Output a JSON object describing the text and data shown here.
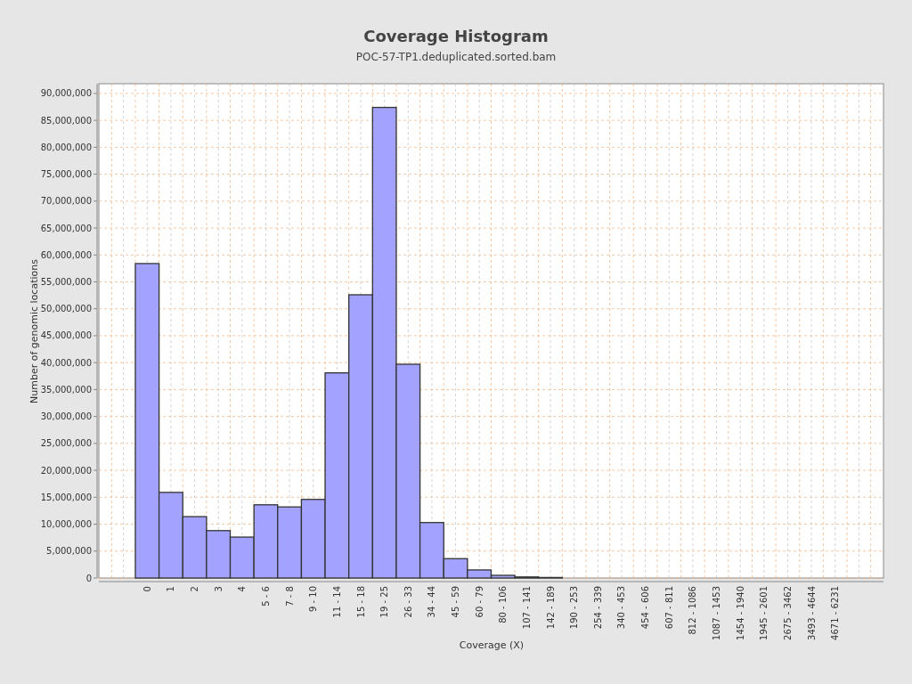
{
  "subtitle": "POC-57-TP1.deduplicated.sorted.bam",
  "chart_data": {
    "type": "bar",
    "title": "Coverage Histogram",
    "xlabel": "Coverage (X)",
    "ylabel": "Number of genomic locations",
    "categories": [
      "0",
      "1",
      "2",
      "3",
      "4",
      "5 - 6",
      "7 - 8",
      "9 - 10",
      "11 - 14",
      "15 - 18",
      "19 - 25",
      "26 - 33",
      "34 - 44",
      "45 - 59",
      "60 - 79",
      "80 - 106",
      "107 - 141",
      "142 - 189",
      "190 - 253",
      "254 - 339",
      "340 - 453",
      "454 - 606",
      "607 - 811",
      "812 - 1086",
      "1087 - 1453",
      "1454 - 1940",
      "1945 - 2601",
      "2675 - 3462",
      "3493 - 4644",
      "4671 - 6231"
    ],
    "grid": true,
    "series": [
      {
        "color": "#a3a3ff",
        "values": [
          58400000,
          15900000,
          11400000,
          8800000,
          7600000,
          13600000,
          13200000,
          14600000,
          38100000,
          52600000,
          87400000,
          39700000,
          10300000,
          3600000,
          1500000,
          500000,
          200000,
          100000,
          0,
          0,
          0,
          0,
          0,
          0,
          0,
          0,
          0,
          0,
          0,
          0
        ]
      }
    ],
    "ylim": [
      0,
      91800000
    ],
    "yticks": [
      {
        "value": 0,
        "label": "0"
      },
      {
        "value": 5000000,
        "label": "5,000,000"
      },
      {
        "value": 10000000,
        "label": "10,000,000"
      },
      {
        "value": 15000000,
        "label": "15,000,000"
      },
      {
        "value": 20000000,
        "label": "20,000,000"
      },
      {
        "value": 25000000,
        "label": "25,000,000"
      },
      {
        "value": 30000000,
        "label": "30,000,000"
      },
      {
        "value": 35000000,
        "label": "35,000,000"
      },
      {
        "value": 40000000,
        "label": "40,000,000"
      },
      {
        "value": 45000000,
        "label": "45,000,000"
      },
      {
        "value": 50000000,
        "label": "50,000,000"
      },
      {
        "value": 55000000,
        "label": "55,000,000"
      },
      {
        "value": 60000000,
        "label": "60,000,000"
      },
      {
        "value": 65000000,
        "label": "65,000,000"
      },
      {
        "value": 70000000,
        "label": "70,000,000"
      },
      {
        "value": 75000000,
        "label": "75,000,000"
      },
      {
        "value": 80000000,
        "label": "80,000,000"
      },
      {
        "value": 85000000,
        "label": "85,000,000"
      },
      {
        "value": 90000000,
        "label": "90,000,000"
      }
    ]
  }
}
